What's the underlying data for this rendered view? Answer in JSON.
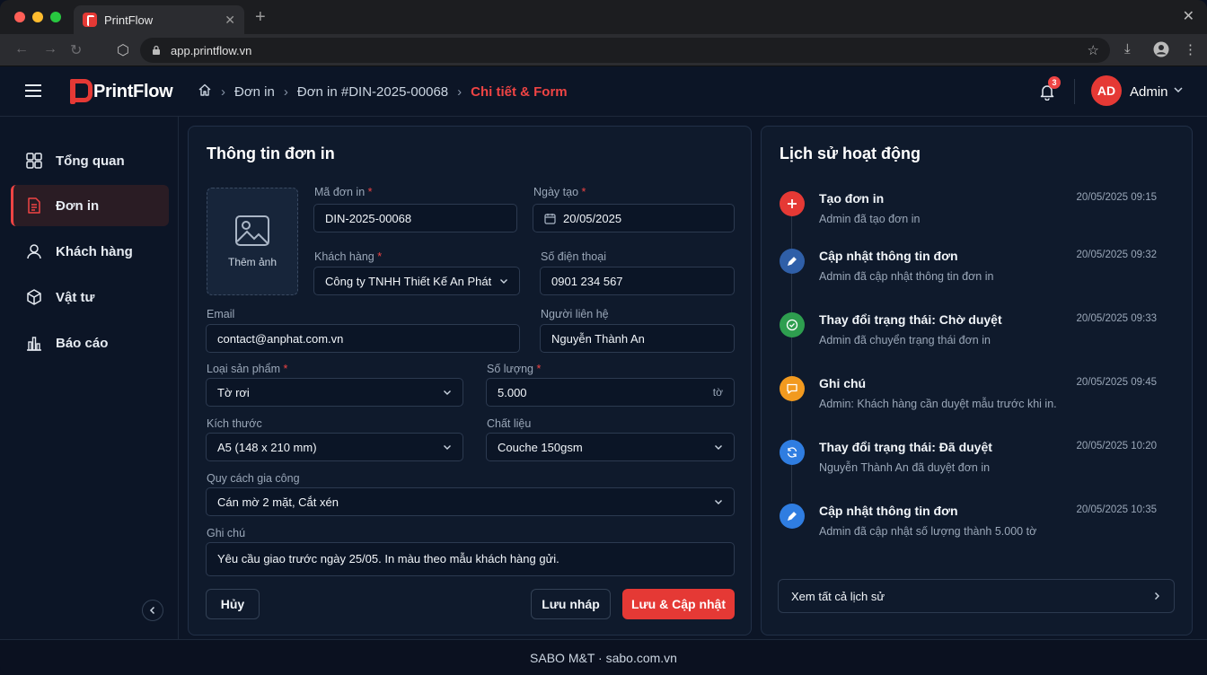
{
  "browser": {
    "tab_title": "PrintFlow",
    "url": "app.printflow.vn"
  },
  "brand": {
    "name": "PrintFlow",
    "accent": "#e53935"
  },
  "breadcrumb": {
    "items": [
      "Đơn in",
      "Đơn in #DIN-2025-00068"
    ],
    "current": "Chi tiết & Form"
  },
  "header": {
    "notification_count": "3",
    "avatar_initials": "AD",
    "user_name": "Admin"
  },
  "sidebar": {
    "items": [
      {
        "label": "Tổng quan",
        "icon": "grid-icon"
      },
      {
        "label": "Đơn in",
        "icon": "document-icon",
        "active": true
      },
      {
        "label": "Khách hàng",
        "icon": "user-icon"
      },
      {
        "label": "Vật tư",
        "icon": "box-icon"
      },
      {
        "label": "Báo cáo",
        "icon": "bar-chart-icon"
      }
    ]
  },
  "form": {
    "title": "Thông tin đơn in",
    "photo_label": "Thêm ảnh",
    "order_code": {
      "label": "Mã đơn in",
      "value": "DIN-2025-00068"
    },
    "created_date": {
      "label": "Ngày tạo",
      "value": "20/05/2025"
    },
    "customer": {
      "label": "Khách hàng",
      "value": "Công ty TNHH Thiết Kế An Phát"
    },
    "phone": {
      "label": "Số điện thoại",
      "value": "0901 234 567"
    },
    "email": {
      "label": "Email",
      "value": "contact@anphat.com.vn"
    },
    "contact": {
      "label": "Người liên hệ",
      "value": "Nguyễn Thành An"
    },
    "product_type": {
      "label": "Loại sản phẩm",
      "value": "Tờ rơi"
    },
    "quantity": {
      "label": "Số lượng",
      "value": "5.000",
      "unit": "tờ"
    },
    "size": {
      "label": "Kích thước",
      "value": "A5 (148 x 210 mm)"
    },
    "material": {
      "label": "Chất liệu",
      "value": "Couche 150gsm"
    },
    "finishing": {
      "label": "Quy cách gia công",
      "value": "Cán mờ 2 mặt, Cắt xén"
    },
    "note": {
      "label": "Ghi chú",
      "value": "Yêu cầu giao trước ngày 25/05. In màu theo mẫu khách hàng gửi."
    },
    "required_mark": "*",
    "buttons": {
      "cancel": "Hủy",
      "draft": "Lưu nháp",
      "save": "Lưu & Cập nhật"
    }
  },
  "history": {
    "title": "Lịch sử hoạt động",
    "items": [
      {
        "title": "Tạo đơn in",
        "time": "20/05/2025 09:15",
        "desc": "Admin đã tạo đơn in",
        "icon": "plus-icon",
        "color": "#e53935"
      },
      {
        "title": "Cập nhật thông tin đơn",
        "time": "20/05/2025 09:32",
        "desc": "Admin đã cập nhật thông tin đơn in",
        "icon": "pencil-icon",
        "color": "#2f5fa8"
      },
      {
        "title": "Thay đổi trạng thái: Chờ duyệt",
        "time": "20/05/2025 09:33",
        "desc": "Admin đã chuyển trạng thái đơn in",
        "icon": "check-circle-icon",
        "color": "#2e9e4f"
      },
      {
        "title": "Ghi chú",
        "time": "20/05/2025 09:45",
        "desc": "Admin: Khách hàng cần duyệt mẫu trước khi in.",
        "icon": "comment-icon",
        "color": "#f29a1f"
      },
      {
        "title": "Thay đổi trạng thái: Đã duyệt",
        "time": "20/05/2025 10:20",
        "desc": "Nguyễn Thành An đã duyệt đơn in",
        "icon": "refresh-icon",
        "color": "#2f7de1"
      },
      {
        "title": "Cập nhật thông tin đơn",
        "time": "20/05/2025 10:35",
        "desc": "Admin đã cập nhật số lượng thành 5.000 tờ",
        "icon": "pencil-icon",
        "color": "#2f7de1"
      }
    ],
    "view_all": "Xem tất cả lịch sử"
  },
  "footer": {
    "text": "SABO M&T · sabo.com.vn"
  }
}
